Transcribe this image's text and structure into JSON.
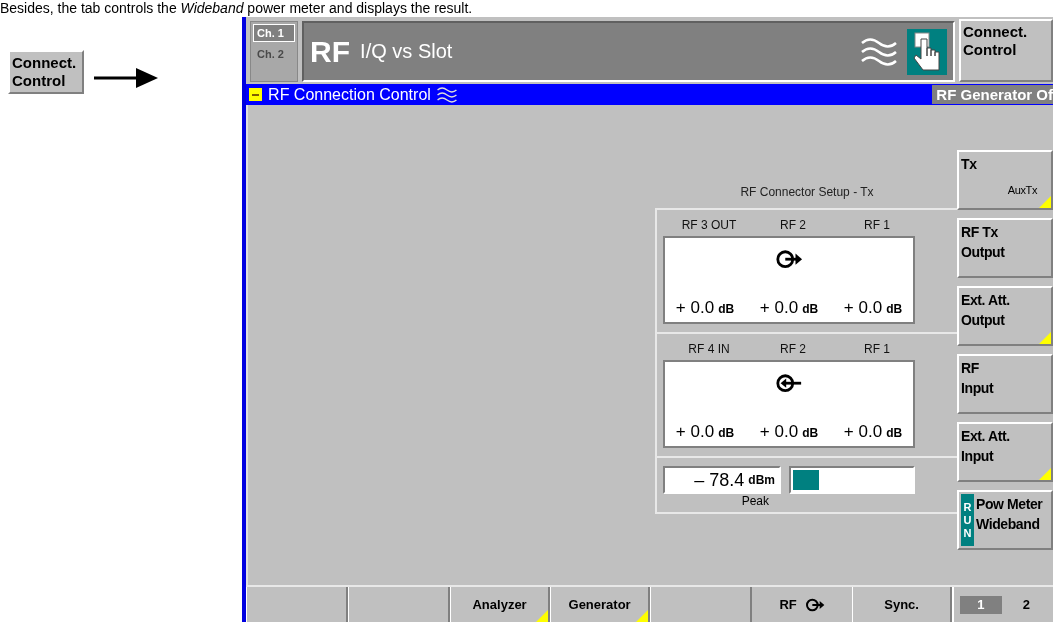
{
  "caption": "Besides, the tab controls the *Wideband* power meter and displays the result.",
  "side_button": {
    "lines": [
      "Connect.",
      "Control"
    ]
  },
  "header": {
    "channels": [
      {
        "label": "Ch. 1",
        "selected": true
      },
      {
        "label": "Ch. 2",
        "selected": false
      }
    ],
    "title": "RF",
    "subtitle": "I/Q vs Slot",
    "connect_button": {
      "lines": [
        "Connect.",
        "Control"
      ]
    }
  },
  "menu_bar": {
    "title": "RF Connection Control",
    "status": "RF Generator Of"
  },
  "connector_setup": {
    "title": "RF Connector Setup - Tx",
    "sections": [
      {
        "kind": "output",
        "labels": [
          "RF 3 OUT",
          "RF 2",
          "RF 1"
        ],
        "values": [
          {
            "value": "+ 0.0",
            "unit": "dB"
          },
          {
            "value": "+ 0.0",
            "unit": "dB"
          },
          {
            "value": "+ 0.0",
            "unit": "dB"
          }
        ]
      },
      {
        "kind": "input",
        "labels": [
          "RF 4 IN",
          "RF 2",
          "RF 1"
        ],
        "values": [
          {
            "value": "+ 0.0",
            "unit": "dB"
          },
          {
            "value": "+ 0.0",
            "unit": "dB"
          },
          {
            "value": "+ 0.0",
            "unit": "dB"
          }
        ]
      }
    ],
    "power_meter": {
      "value": "– 78.4",
      "unit": "dBm",
      "label": "Peak",
      "level": 0.22
    }
  },
  "softkeys": [
    {
      "kind": "plain",
      "lines": [
        "Tx"
      ],
      "sub": "AuxTx",
      "corner": true
    },
    {
      "kind": "plain",
      "lines": [
        "RF Tx",
        "Output"
      ],
      "corner": false
    },
    {
      "kind": "plain",
      "lines": [
        "Ext. Att.",
        "Output"
      ],
      "corner": true
    },
    {
      "kind": "plain",
      "lines": [
        "RF",
        "Input"
      ],
      "corner": false
    },
    {
      "kind": "plain",
      "lines": [
        "Ext. Att.",
        "Input"
      ],
      "corner": true
    },
    {
      "kind": "run",
      "run_label": "RUN",
      "lines": [
        "Pow Meter",
        "Wideband"
      ],
      "corner": false
    }
  ],
  "bottom_bar": {
    "slots": [
      {
        "kind": "blank"
      },
      {
        "kind": "blank"
      },
      {
        "kind": "button",
        "label": "Analyzer",
        "corner": true
      },
      {
        "kind": "button",
        "label": "Generator",
        "corner": true
      },
      {
        "kind": "blank"
      },
      {
        "kind": "status",
        "label": "RF"
      },
      {
        "kind": "button",
        "label": "Sync.",
        "corner": false
      }
    ],
    "pages": [
      {
        "label": "1",
        "selected": true
      },
      {
        "label": "2",
        "selected": false
      }
    ]
  }
}
